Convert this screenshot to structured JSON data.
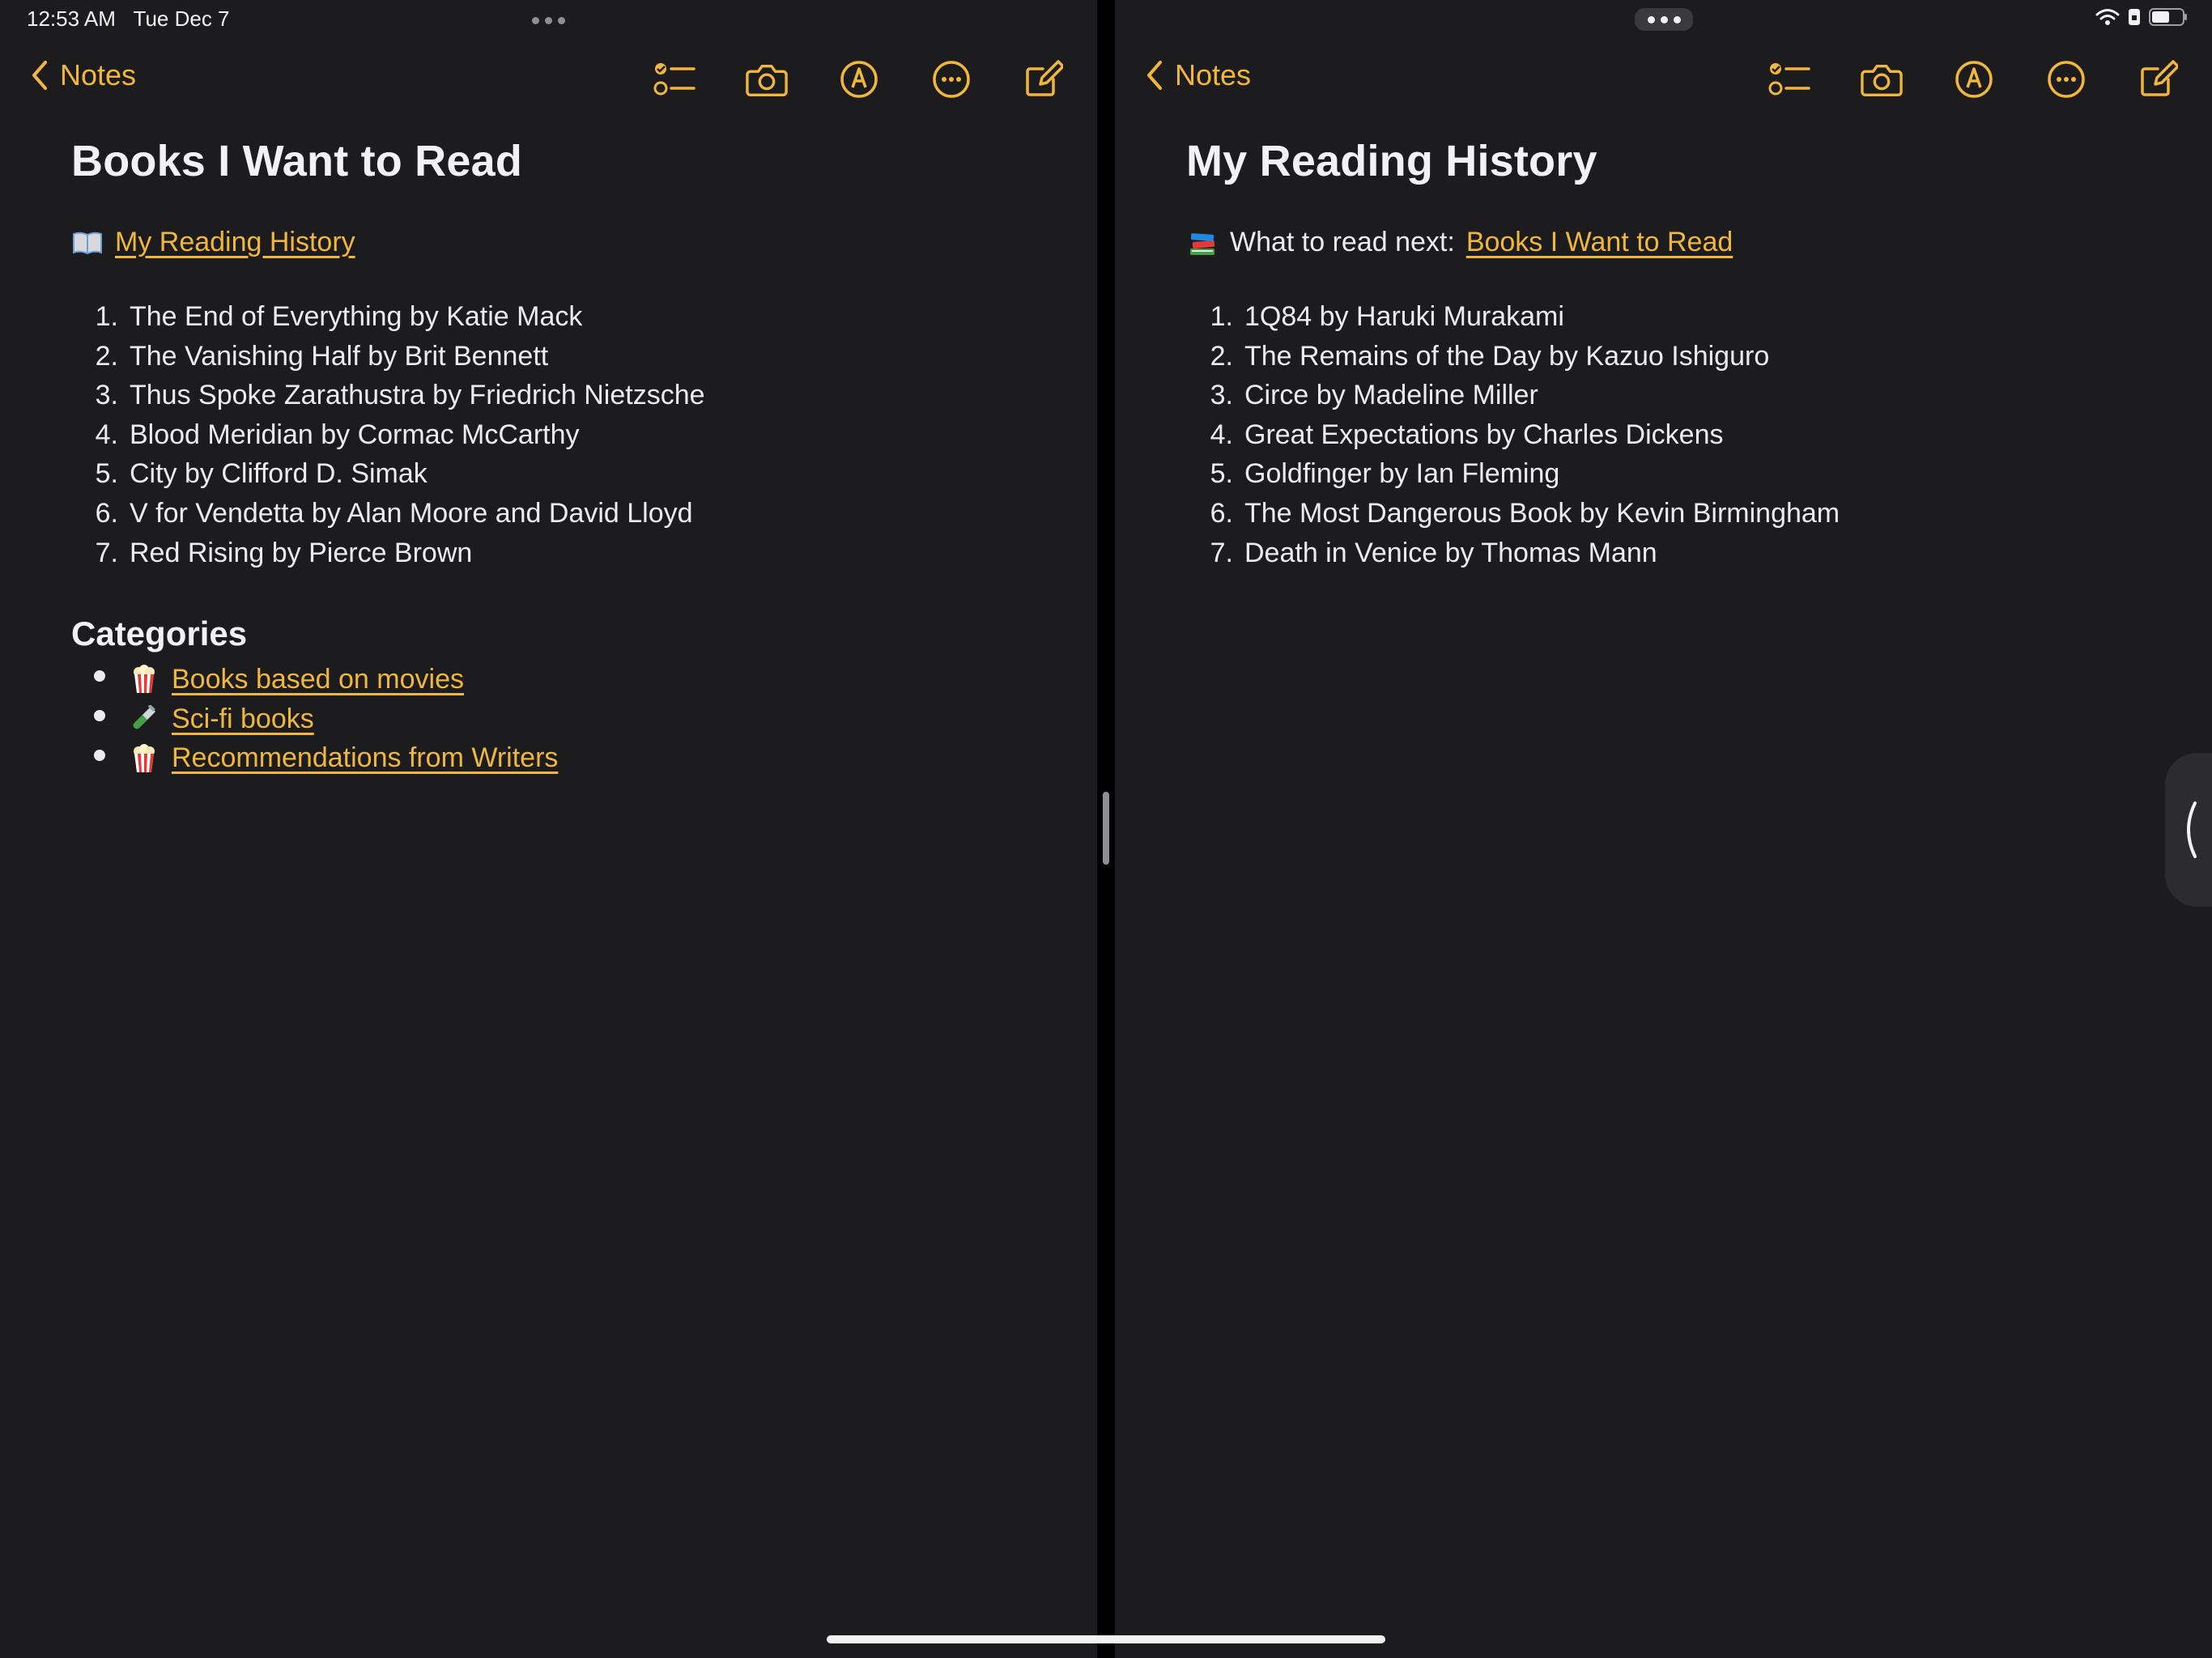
{
  "status": {
    "time": "12:53 AM",
    "date": "Tue Dec 7"
  },
  "accent": "#f0b73a",
  "left": {
    "back_label": "Notes",
    "title": "Books I Want to Read",
    "link_label": "My Reading History",
    "books": [
      {
        "n": "1.",
        "t": "The End of Everything by Katie Mack"
      },
      {
        "n": "2.",
        "t": "The Vanishing Half by Brit Bennett"
      },
      {
        "n": "3.",
        "t": "Thus Spoke Zarathustra by Friedrich Nietzsche"
      },
      {
        "n": "4.",
        "t": "Blood Meridian by Cormac McCarthy"
      },
      {
        "n": "5.",
        "t": "City by Clifford D. Simak"
      },
      {
        "n": "6.",
        "t": "V for Vendetta by Alan Moore and David Lloyd"
      },
      {
        "n": "7.",
        "t": "Red Rising by Pierce Brown"
      }
    ],
    "categories_heading": "Categories",
    "categories": [
      {
        "icon": "popcorn-icon",
        "label": "Books based on movies"
      },
      {
        "icon": "test-tube-icon",
        "label": "Sci-fi books"
      },
      {
        "icon": "popcorn-icon",
        "label": "Recommendations from Writers"
      }
    ]
  },
  "right": {
    "back_label": "Notes",
    "title": "My Reading History",
    "prefix": "What to read next:",
    "link_label": "Books I Want to Read",
    "books": [
      {
        "n": "1.",
        "t": "1Q84 by Haruki Murakami"
      },
      {
        "n": "2.",
        "t": "The Remains of the Day by Kazuo Ishiguro"
      },
      {
        "n": "3.",
        "t": "Circe by Madeline Miller"
      },
      {
        "n": "4.",
        "t": "Great Expectations by Charles Dickens"
      },
      {
        "n": "5.",
        "t": "Goldfinger by Ian Fleming"
      },
      {
        "n": "6.",
        "t": "The Most Dangerous Book by Kevin Birmingham"
      },
      {
        "n": "7.",
        "t": "Death in Venice by Thomas Mann"
      }
    ]
  },
  "toolbar_icons": [
    "checklist-icon",
    "camera-icon",
    "markup-icon",
    "more-icon",
    "compose-icon"
  ]
}
